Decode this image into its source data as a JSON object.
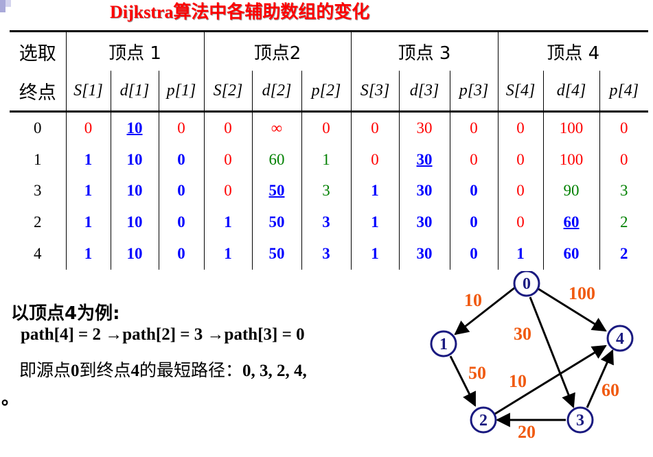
{
  "title": "Dijkstra算法中各辅助数组的变化",
  "table": {
    "corner_top": "选取",
    "corner_bottom": "终点",
    "groups": [
      "顶点 1",
      "顶点2",
      "顶点 3",
      "顶点 4"
    ],
    "subheaders": [
      "S[1]",
      "d[1]",
      "p[1]",
      "S[2]",
      "d[2]",
      "p[2]",
      "S[3]",
      "d[3]",
      "p[3]",
      "S[4]",
      "d[4]",
      "p[4]"
    ],
    "rows": [
      {
        "label": "0",
        "cells": [
          "0",
          "10",
          "0",
          "0",
          "∞",
          "0",
          "0",
          "30",
          "0",
          "0",
          "100",
          "0"
        ]
      },
      {
        "label": "1",
        "cells": [
          "1",
          "10",
          "0",
          "0",
          "60",
          "1",
          "0",
          "30",
          "0",
          "0",
          "100",
          "0"
        ]
      },
      {
        "label": "3",
        "cells": [
          "1",
          "10",
          "0",
          "0",
          "50",
          "3",
          "1",
          "30",
          "0",
          "0",
          "90",
          "3"
        ]
      },
      {
        "label": "2",
        "cells": [
          "1",
          "10",
          "0",
          "1",
          "50",
          "3",
          "1",
          "30",
          "0",
          "0",
          "60",
          "2"
        ]
      },
      {
        "label": "4",
        "cells": [
          "1",
          "10",
          "0",
          "1",
          "50",
          "3",
          "1",
          "30",
          "0",
          "1",
          "60",
          "2"
        ]
      }
    ]
  },
  "example": {
    "heading": "以顶点4为例:",
    "path_line": "path[4] = 2 →path[2] = 3 →path[3] = 0",
    "result_prefix": "即源点",
    "result_src": "0",
    "result_mid1": "到终点",
    "result_dst": "4",
    "result_mid2": "的最短路径：",
    "result_path": "0, 3, 2, 4,",
    "period": "。"
  },
  "graph": {
    "nodes": [
      "0",
      "1",
      "2",
      "3",
      "4"
    ],
    "edges": [
      {
        "from": "0",
        "to": "1",
        "weight": "10"
      },
      {
        "from": "0",
        "to": "4",
        "weight": "100"
      },
      {
        "from": "0",
        "to": "3",
        "weight": "30"
      },
      {
        "from": "1",
        "to": "2",
        "weight": "50"
      },
      {
        "from": "2",
        "to": "4",
        "weight": "10"
      },
      {
        "from": "3",
        "to": "2",
        "weight": "20"
      },
      {
        "from": "3",
        "to": "4",
        "weight": "60"
      }
    ],
    "colors": {
      "node_stroke": "#1a1a80",
      "weight": "#f05a10"
    }
  },
  "colors": {
    "title": "#ff0000",
    "in_set": "#0000ff",
    "updated": "#008000",
    "unvisited": "#ff0000"
  }
}
